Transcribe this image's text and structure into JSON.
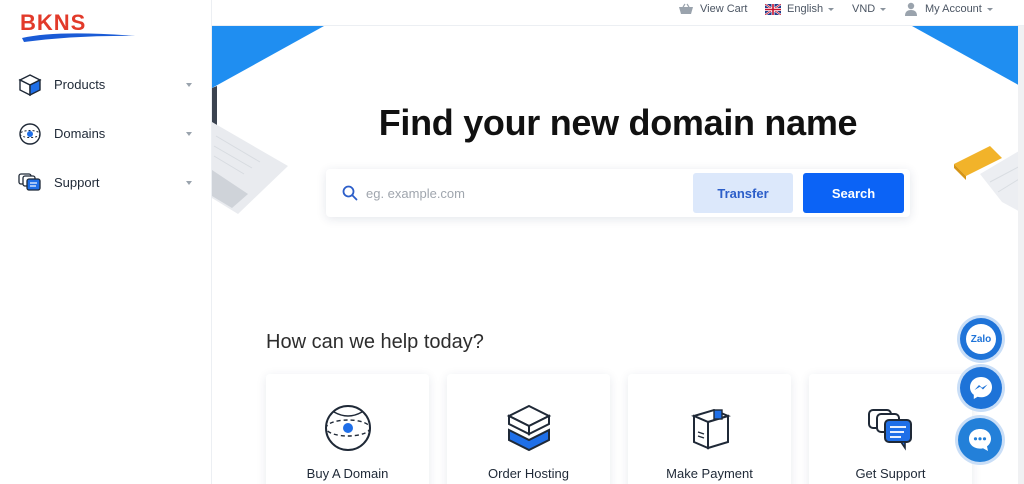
{
  "brand": {
    "logo_text": "BKNS",
    "red": "#e23a2a",
    "blue": "#1a5bd6"
  },
  "sidebar": {
    "items": [
      {
        "label": "Products",
        "icon": "box-icon"
      },
      {
        "label": "Domains",
        "icon": "globe-icon"
      },
      {
        "label": "Support",
        "icon": "chat-bubbles-icon"
      }
    ]
  },
  "topbar": {
    "view_cart": "View Cart",
    "language": "English",
    "currency": "VND",
    "account": "My Account"
  },
  "hero": {
    "title": "Find your new domain name",
    "search_placeholder": "eg. example.com",
    "transfer_label": "Transfer",
    "search_label": "Search"
  },
  "help": {
    "heading": "How can we help today?",
    "cards": [
      {
        "label": "Buy A Domain",
        "icon": "globe-icon"
      },
      {
        "label": "Order Hosting",
        "icon": "server-box-icon"
      },
      {
        "label": "Make Payment",
        "icon": "package-icon"
      },
      {
        "label": "Get Support",
        "icon": "chat-bubbles-icon"
      }
    ]
  },
  "floating": {
    "zalo_label": "Zalo"
  },
  "colors": {
    "accent": "#0b63f6",
    "accent_light": "#dce8fb",
    "decor_blue": "#1f8ef1"
  }
}
